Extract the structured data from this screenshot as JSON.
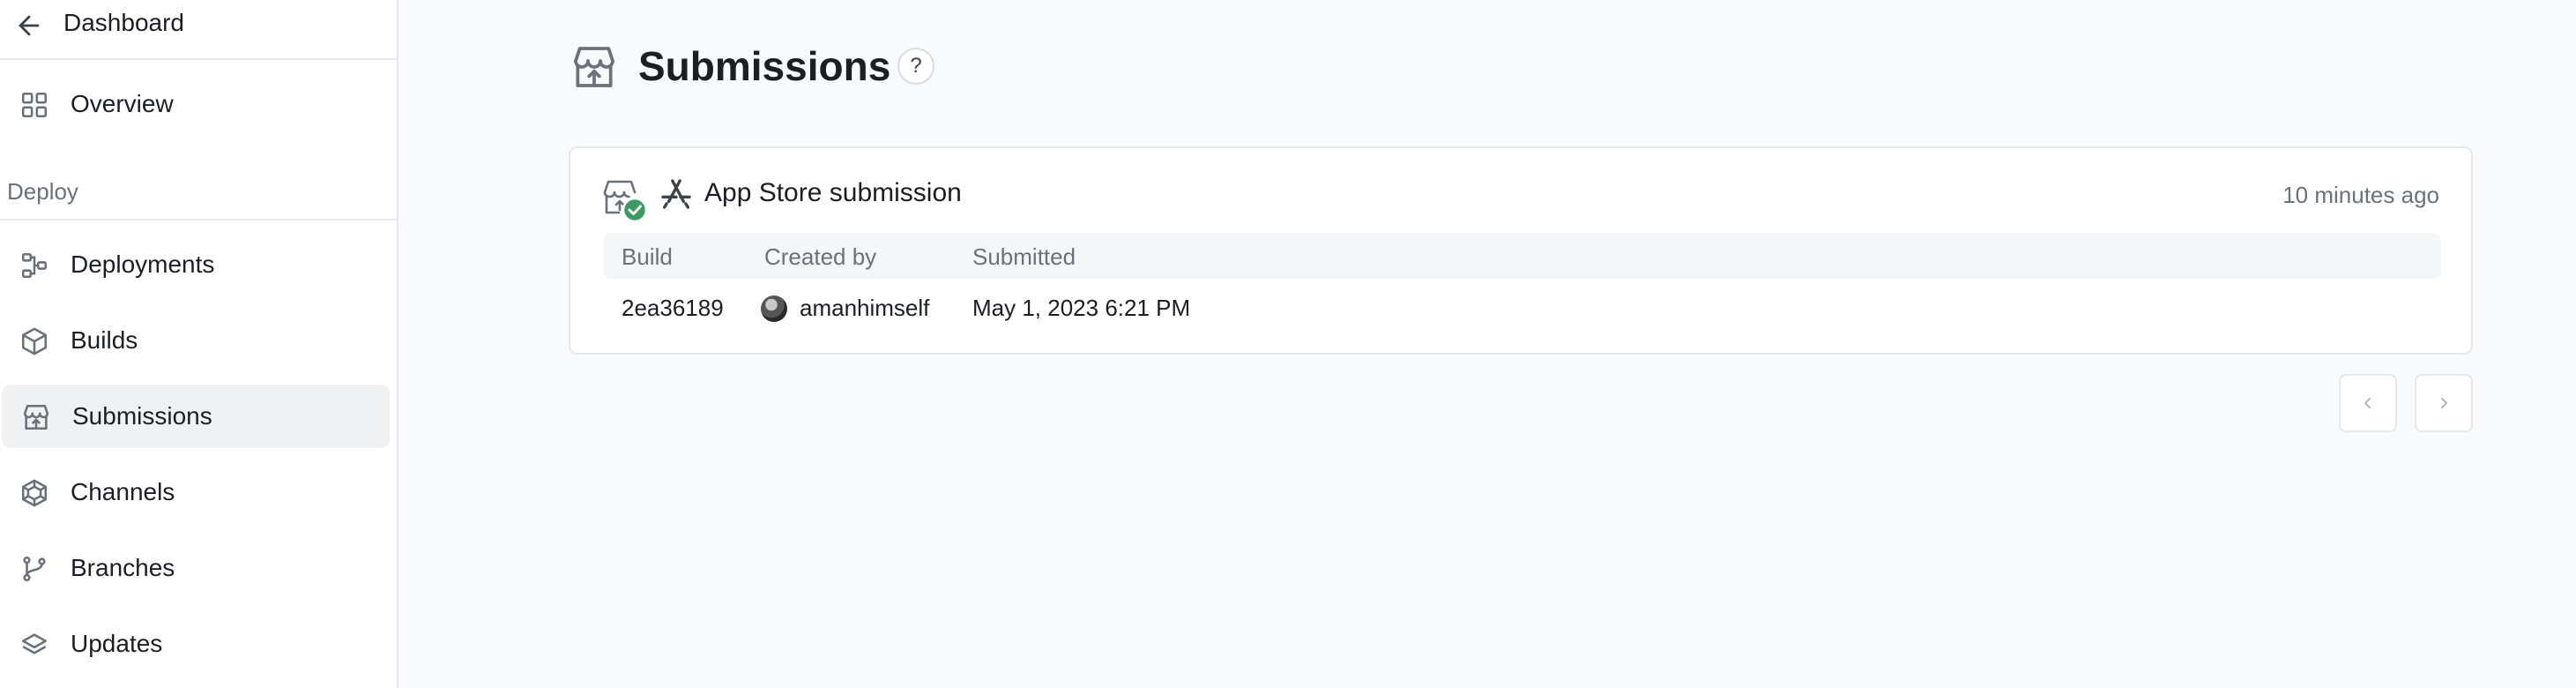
{
  "sidebar": {
    "back_label": "Dashboard",
    "overview_label": "Overview",
    "section_label": "Deploy",
    "items": [
      {
        "label": "Deployments",
        "icon": "deployments-icon"
      },
      {
        "label": "Builds",
        "icon": "box-icon"
      },
      {
        "label": "Submissions",
        "icon": "store-upload-icon",
        "active": true
      },
      {
        "label": "Channels",
        "icon": "channels-icon"
      },
      {
        "label": "Branches",
        "icon": "git-branch-icon"
      },
      {
        "label": "Updates",
        "icon": "layers-icon"
      }
    ]
  },
  "header": {
    "title": "Submissions",
    "help_label": "?"
  },
  "submission": {
    "title": "App Store submission",
    "time": "10 minutes ago",
    "status_color": "#3e9a63",
    "columns": [
      "Build",
      "Created by",
      "Submitted"
    ],
    "row": {
      "build": "2ea36189",
      "created_by": "amanhimself",
      "submitted": "May 1, 2023 6:21 PM"
    }
  },
  "pagination": {
    "prev_icon": "chevron-left-icon",
    "next_icon": "chevron-right-icon"
  }
}
